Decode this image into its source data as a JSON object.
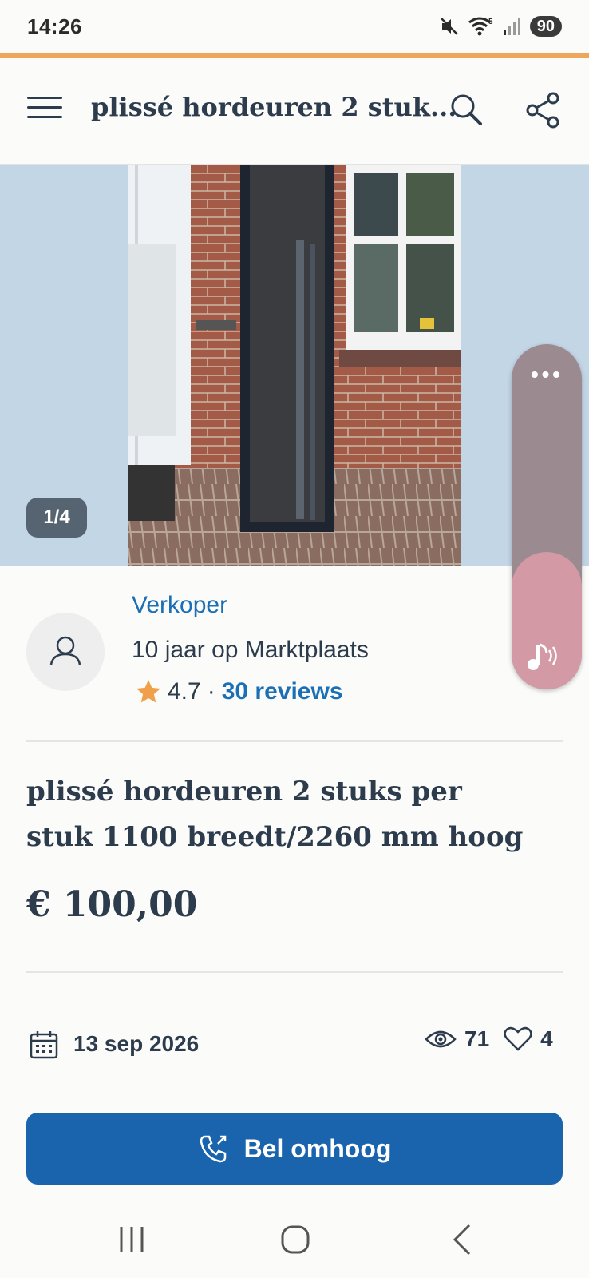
{
  "status_bar": {
    "time": "14:26",
    "battery": "90",
    "wifi_badge": "5",
    "icons": [
      "mute-icon",
      "wifi-icon",
      "signal-icon",
      "battery-icon"
    ]
  },
  "header": {
    "title": "plissé hordeuren 2 stuk...",
    "icons": [
      "menu-icon",
      "search-icon",
      "share-icon"
    ]
  },
  "gallery": {
    "counter": "1/4"
  },
  "seller": {
    "label": "Verkoper",
    "years": "10 jaar op Marktplaats",
    "rating": "4.7",
    "separator": "·",
    "reviews": "30 reviews"
  },
  "listing": {
    "title": "plissé hordeuren 2 stuks per stuk 1100 breedt/2260 mm hoog",
    "price": "€ 100,00",
    "date": "13 sep 2026",
    "views": "71",
    "favorites": "4"
  },
  "cta": {
    "label": "Bel omhoog"
  },
  "colors": {
    "accent": "#eea65b",
    "brand_blue": "#1a64ad",
    "link_blue": "#1b6fb5",
    "text_dark": "#2d3c4d",
    "star": "#f0a04b"
  }
}
